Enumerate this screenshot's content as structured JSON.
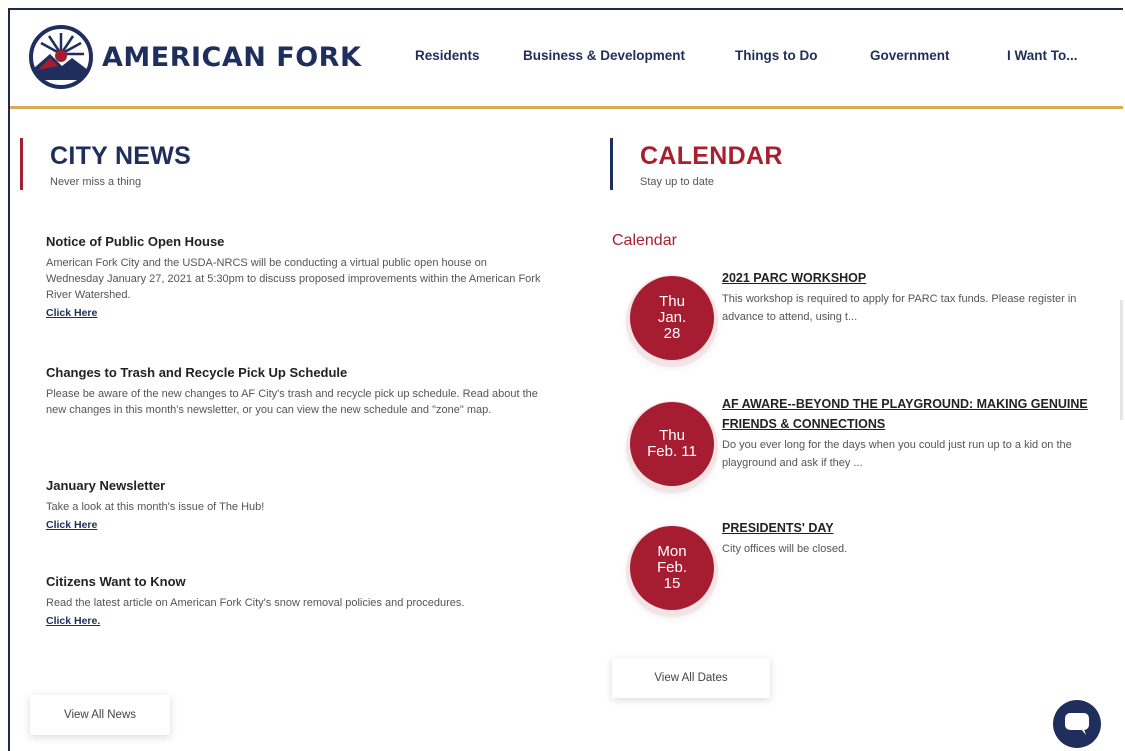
{
  "header": {
    "logo_text": "AMERICAN FORK",
    "nav": [
      "Residents",
      "Business & Development",
      "Things to Do",
      "Government",
      "I Want To..."
    ]
  },
  "news": {
    "title": "CITY NEWS",
    "subtitle": "Never miss a thing",
    "items": [
      {
        "title": "Notice of Public Open House",
        "body": "American Fork City and the USDA-NRCS will be conducting a virtual public open house on Wednesday January 27, 2021 at 5:30pm to discuss proposed improvements within the American Fork River Watershed.",
        "link": "Click Here"
      },
      {
        "title": "Changes to Trash and Recycle Pick Up Schedule",
        "body": "Please be aware of the new changes to AF City's trash and recycle pick up schedule. Read about the new changes in this month's newsletter, or you can view the new schedule and \"zone\" map.",
        "link": ""
      },
      {
        "title": "January Newsletter",
        "body": "Take a look at this month's issue of The Hub!",
        "link": "Click Here"
      },
      {
        "title": "Citizens Want to Know",
        "body": "Read the latest article on American Fork City's snow removal policies and procedures.",
        "link": "Click Here."
      }
    ],
    "view_all": "View All News"
  },
  "calendar": {
    "title": "CALENDAR",
    "subtitle": "Stay up to date",
    "heading": "Calendar",
    "events": [
      {
        "day": "Thu",
        "month": "Jan.",
        "date": "28",
        "title": "2021 PARC WORKSHOP",
        "desc": "This workshop is required to apply for PARC tax funds. Please register in advance to attend, using t..."
      },
      {
        "day": "Thu",
        "month": "Feb. 11",
        "date": "",
        "title": "AF AWARE--BEYOND THE PLAYGROUND: MAKING GENUINE FRIENDS & CONNECTIONS",
        "desc": "Do you ever long for the days when you could just run up to a kid on the playground and ask if they ..."
      },
      {
        "day": "Mon",
        "month": "Feb.",
        "date": "15",
        "title": "PRESIDENTS' DAY",
        "desc": "City offices will be closed."
      }
    ],
    "view_all": "View All Dates"
  },
  "colors": {
    "navy": "#1f2e5c",
    "red": "#a61d32",
    "gold": "#d9a95a"
  },
  "icons": {
    "chat": "chat-bubble-icon"
  }
}
